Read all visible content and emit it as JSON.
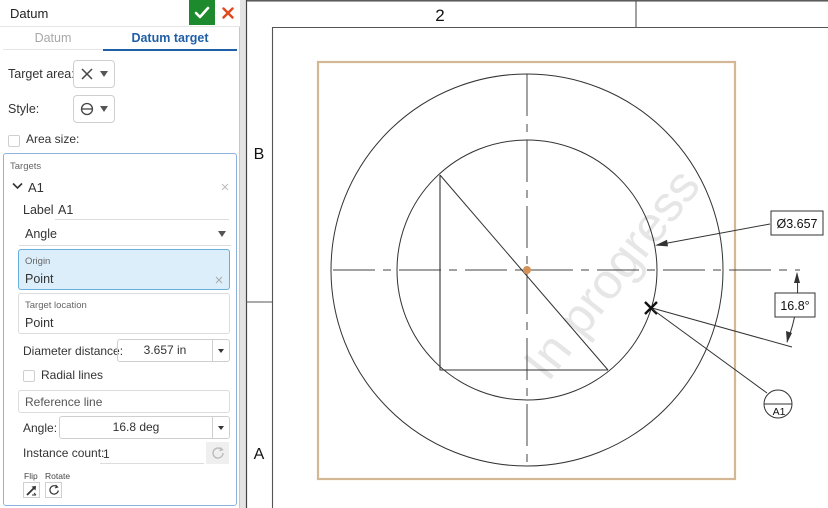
{
  "panel": {
    "title": "Datum",
    "confirm_icon": "checkmark-icon",
    "cancel_icon": "close-x-icon",
    "tabs": [
      {
        "label": "Datum",
        "active": false
      },
      {
        "label": "Datum target",
        "active": true
      }
    ],
    "target_area": {
      "label": "Target area:",
      "icon": "cross-x-icon"
    },
    "style": {
      "label": "Style:",
      "icon": "circle-bar-icon"
    },
    "area_size": {
      "label": "Area size:",
      "checked": false
    },
    "targets": {
      "header": "Targets",
      "item": {
        "name": "A1",
        "label_caption": "Label",
        "label_value": "A1",
        "mode": "Angle",
        "origin": {
          "caption": "Origin",
          "value": "Point"
        },
        "target_location": {
          "caption": "Target location",
          "value": "Point"
        },
        "diameter_distance": {
          "label": "Diameter distance:",
          "value": "3.657 in"
        },
        "radial_lines": {
          "label": "Radial lines",
          "checked": false
        },
        "reference_line": {
          "placeholder": "Reference line"
        },
        "angle": {
          "label": "Angle:",
          "value": "16.8 deg"
        },
        "instance_count": {
          "label": "Instance count:",
          "value": "1"
        },
        "flip_label": "Flip",
        "rotate_label": "Rotate"
      }
    }
  },
  "drawing": {
    "zone_top": "2",
    "zone_left_upper": "B",
    "zone_left_lower": "A",
    "watermark": "In progress",
    "diameter_annotation": "Ø3.657",
    "angle_annotation": "16.8°",
    "datum_target_label": "A1",
    "colors": {
      "view_border": "#d4b896",
      "origin_point": "#d4925a",
      "line": "#333333",
      "accent_blue": "#1f5fa6",
      "confirm_green": "#1e8a2e",
      "cancel_red": "#e0481e"
    }
  }
}
